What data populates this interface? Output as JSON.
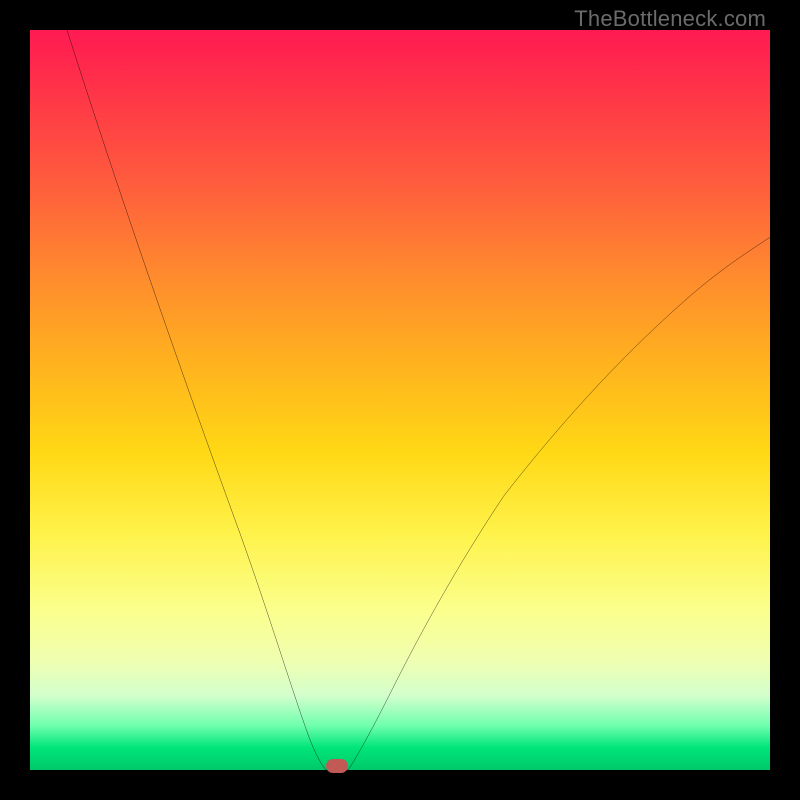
{
  "watermark": "TheBottleneck.com",
  "colors": {
    "frame": "#000000",
    "curve": "#000000",
    "marker": "#c15a55",
    "gradient_stops": [
      {
        "pct": 0,
        "hex": "#ff1a52"
      },
      {
        "pct": 8,
        "hex": "#ff3348"
      },
      {
        "pct": 20,
        "hex": "#ff5a3e"
      },
      {
        "pct": 33,
        "hex": "#ff8a2e"
      },
      {
        "pct": 45,
        "hex": "#ffb21e"
      },
      {
        "pct": 57,
        "hex": "#ffd815"
      },
      {
        "pct": 68,
        "hex": "#fff24a"
      },
      {
        "pct": 78,
        "hex": "#fbff8a"
      },
      {
        "pct": 85,
        "hex": "#f0ffb0"
      },
      {
        "pct": 90,
        "hex": "#d2ffcc"
      },
      {
        "pct": 94,
        "hex": "#6fffad"
      },
      {
        "pct": 97,
        "hex": "#00e57a"
      },
      {
        "pct": 100,
        "hex": "#00c86a"
      }
    ]
  },
  "chart_data": {
    "type": "line",
    "title": "",
    "xlabel": "",
    "ylabel": "",
    "xlim": [
      0,
      100
    ],
    "ylim": [
      0,
      100
    ],
    "series": [
      {
        "name": "left-branch",
        "x": [
          5,
          8,
          12,
          16,
          20,
          24,
          28,
          31,
          33,
          35,
          36.5,
          37.5,
          38.3,
          39,
          39.5,
          40
        ],
        "values": [
          100,
          90,
          78,
          66,
          55,
          44,
          33,
          24,
          18,
          12,
          8,
          5,
          3,
          1.5,
          0.6,
          0
        ]
      },
      {
        "name": "plateau",
        "x": [
          40,
          43
        ],
        "values": [
          0,
          0
        ]
      },
      {
        "name": "right-branch",
        "x": [
          43,
          44,
          46,
          49,
          53,
          58,
          64,
          71,
          79,
          88,
          97,
          100
        ],
        "values": [
          0,
          1.5,
          5,
          11,
          19,
          28,
          37,
          46,
          55,
          63,
          70,
          72
        ]
      }
    ],
    "marker": {
      "x": 41.5,
      "y": 0.6
    },
    "notes": "V-shaped bottleneck curve on rainbow gradient; values estimated from pixels (no visible axis ticks)."
  }
}
